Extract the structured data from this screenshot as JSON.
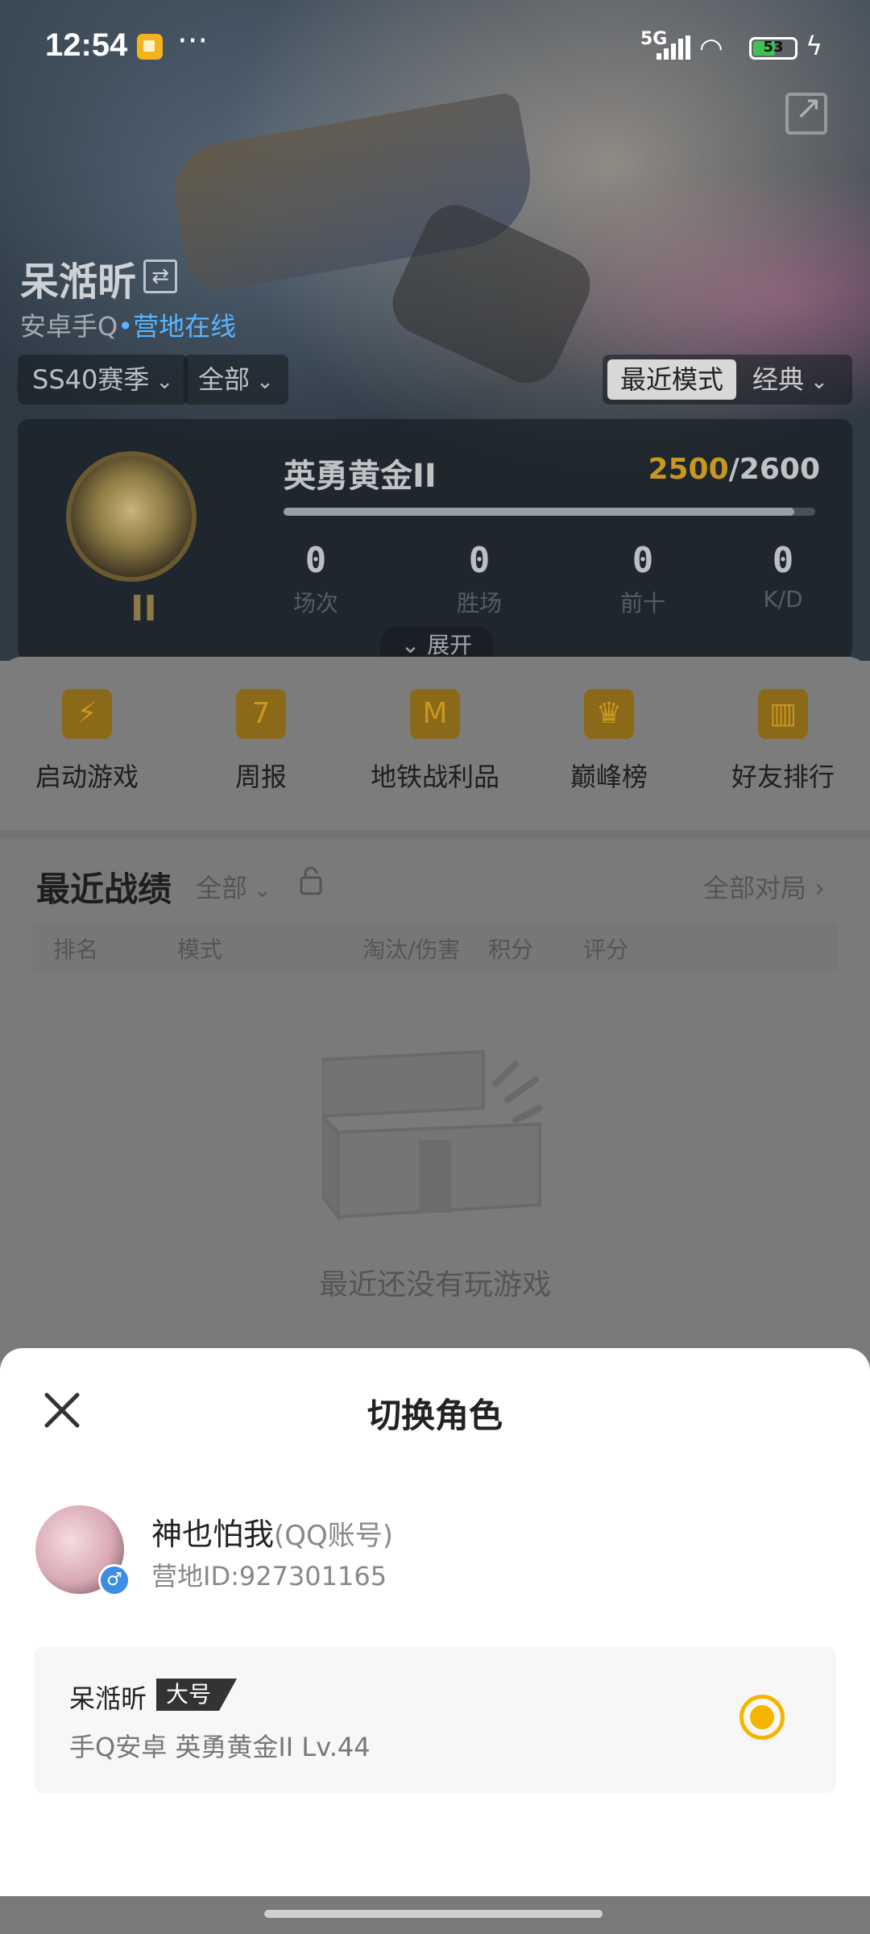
{
  "status_bar": {
    "time": "12:54",
    "network": "5G",
    "battery": "53",
    "battery_fraction": 0.53
  },
  "header": {
    "player_name": "呆湉昕",
    "swap_icon": "⇄",
    "platform": "安卓手Q",
    "separator": "•",
    "online_status": "营地在线",
    "season_filter": "SS40赛季",
    "scope_filter": "全部",
    "mode_active": "最近模式",
    "mode_other": "经典"
  },
  "rank": {
    "title": "英勇黄金II",
    "roman": "II",
    "score_current": "2500",
    "score_total": "/2600",
    "progress": 0.96,
    "stats": [
      {
        "value": "0",
        "label": "场次"
      },
      {
        "value": "0",
        "label": "胜场"
      },
      {
        "value": "0",
        "label": "前十"
      },
      {
        "value": "0",
        "label": "K/D"
      }
    ],
    "expand_label": "展开"
  },
  "quick_actions": [
    {
      "icon": "lightning-icon",
      "glyph": "⚡",
      "label": "启动游戏"
    },
    {
      "icon": "calendar-icon",
      "glyph": "7",
      "label": "周报"
    },
    {
      "icon": "metro-badge-icon",
      "glyph": "M",
      "label": "地铁战利品"
    },
    {
      "icon": "trophy-shield-icon",
      "glyph": "♛",
      "label": "巅峰榜"
    },
    {
      "icon": "podium-icon",
      "glyph": "▥",
      "label": "好友排行"
    }
  ],
  "recent": {
    "title": "最近战绩",
    "filter": "全部",
    "all_matches": "全部对局",
    "columns": [
      "排名",
      "模式",
      "淘汰/伤害",
      "积分",
      "评分"
    ],
    "empty_text": "最近还没有玩游戏"
  },
  "sheet": {
    "title": "切换角色",
    "account_name": "神也怕我",
    "account_type": "(QQ账号)",
    "camp_id": "营地ID:927301165",
    "gender_glyph": "♂",
    "role": {
      "name": "呆湉昕",
      "tag": "大号",
      "info": "手Q安卓  英勇黄金II  Lv.44"
    }
  }
}
